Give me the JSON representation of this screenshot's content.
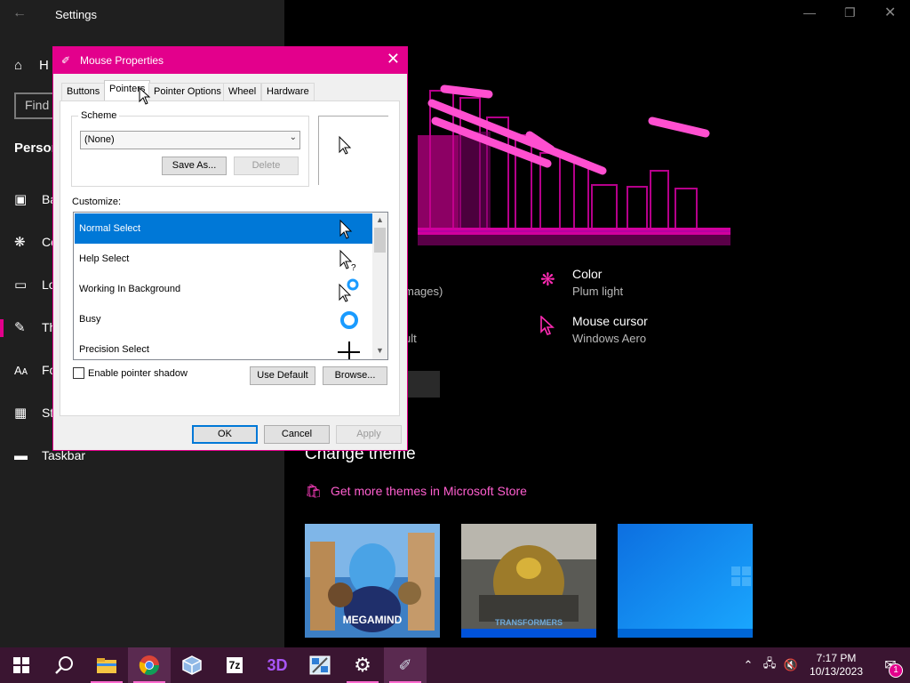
{
  "settings_window": {
    "title": "Settings",
    "sidebar": {
      "home_label": "H",
      "find_placeholder": "Find",
      "section_heading": "Person",
      "items": [
        {
          "label": "Ba",
          "icon": "image-icon"
        },
        {
          "label": "Co",
          "icon": "palette-icon"
        },
        {
          "label": "Lo",
          "icon": "lock-screen-icon"
        },
        {
          "label": "Th",
          "icon": "themes-icon"
        },
        {
          "label": "Fo",
          "icon": "fonts-icon"
        },
        {
          "label": "St",
          "icon": "start-icon"
        },
        {
          "label": "Taskbar",
          "icon": "taskbar-icon"
        }
      ]
    },
    "main": {
      "partial_text_1": "mages)",
      "partial_text_2": "ult",
      "color_option": {
        "title": "Color",
        "value": "Plum light"
      },
      "mouse_option": {
        "title": "Mouse cursor",
        "value": "Windows Aero"
      },
      "change_theme_heading": "Change theme",
      "store_link": "Get more themes in Microsoft Store",
      "theme_thumbnails": [
        "MEGAMIND",
        "TRANSFORMERS",
        ""
      ]
    }
  },
  "dialog": {
    "title": "Mouse Properties",
    "tabs": [
      "Buttons",
      "Pointers",
      "Pointer Options",
      "Wheel",
      "Hardware"
    ],
    "active_tab": "Pointers",
    "scheme_label": "Scheme",
    "scheme_value": "(None)",
    "save_as": "Save As...",
    "delete": "Delete",
    "customize_label": "Customize:",
    "cursor_rows": [
      "Normal Select",
      "Help Select",
      "Working In Background",
      "Busy",
      "Precision Select"
    ],
    "selected_row": "Normal Select",
    "pointer_shadow_label": "Enable pointer shadow",
    "use_default": "Use Default",
    "browse": "Browse...",
    "ok": "OK",
    "cancel": "Cancel",
    "apply": "Apply"
  },
  "taskbar": {
    "time": "7:17 PM",
    "date": "10/13/2023",
    "notification_count": "1",
    "apps": [
      "start-icon",
      "search-icon",
      "file-explorer-icon",
      "chrome-icon",
      "virtualbox-icon",
      "7zip-icon",
      "3d-app-icon",
      "paint-icon",
      "settings-icon",
      "mouse-properties-icon"
    ],
    "tray_icons": [
      "chevron-up-icon",
      "network-icon",
      "volume-muted-icon",
      "notification-icon"
    ]
  },
  "colors": {
    "accent": "#e3008c",
    "taskbar": "#3a1531",
    "selection": "#0078d7"
  }
}
